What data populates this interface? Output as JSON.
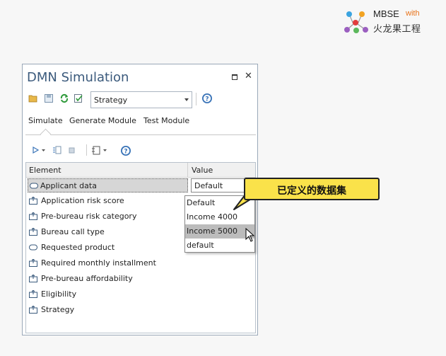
{
  "logo": {
    "brand": "MBSE",
    "with": "with",
    "subtitle": "火龙果工程"
  },
  "window": {
    "title": "DMN Simulation",
    "toolbar": {
      "combo_value": "Strategy"
    },
    "tabs": [
      {
        "label": "Simulate",
        "active": true
      },
      {
        "label": "Generate Module"
      },
      {
        "label": "Test Module"
      }
    ]
  },
  "grid": {
    "columns": [
      "Element",
      "Value"
    ],
    "rows": [
      {
        "label": "Applicant data",
        "icon": "input-data-icon",
        "value": "Default",
        "selected": true
      },
      {
        "label": "Application risk score",
        "icon": "decision-icon"
      },
      {
        "label": "Pre-bureau risk category",
        "icon": "decision-icon"
      },
      {
        "label": "Bureau call type",
        "icon": "decision-icon"
      },
      {
        "label": "Requested product",
        "icon": "input-data-icon"
      },
      {
        "label": "Required monthly installment",
        "icon": "decision-icon"
      },
      {
        "label": "Pre-bureau affordability",
        "icon": "decision-icon"
      },
      {
        "label": "Eligibility",
        "icon": "decision-icon"
      },
      {
        "label": "Strategy",
        "icon": "decision-icon"
      }
    ]
  },
  "dropdown": {
    "options": [
      "Default",
      "Income 4000",
      "Income 5000",
      "default"
    ],
    "highlighted_index": 2
  },
  "callout": {
    "text": "已定义的数据集",
    "color": "#fae24a"
  }
}
